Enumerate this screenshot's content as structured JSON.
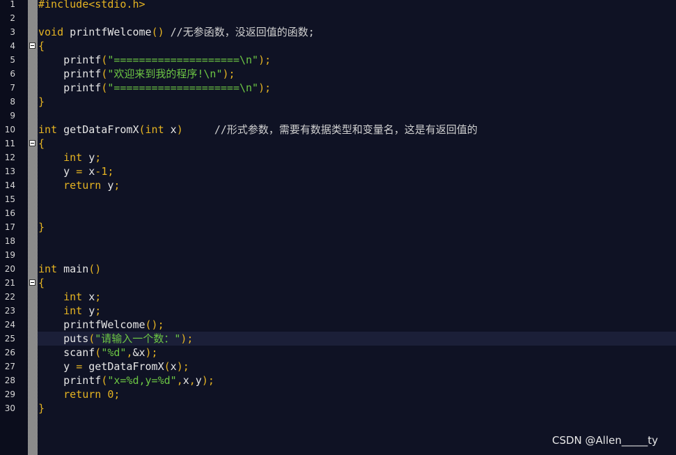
{
  "editor": {
    "colors": {
      "background": "#0f1224",
      "keyword": "#e6b422",
      "string": "#6cc644",
      "text": "#e6e6e6",
      "line_number": "#d8d8d8",
      "current_line": "#1b1f38"
    },
    "fold_markers": [
      4,
      11,
      21
    ],
    "current_line": 25,
    "lines": [
      {
        "n": "1",
        "tokens": [
          {
            "t": "pp",
            "v": "#include<stdio.h>"
          }
        ]
      },
      {
        "n": "2",
        "tokens": []
      },
      {
        "n": "3",
        "tokens": [
          {
            "t": "kw",
            "v": "void"
          },
          {
            "t": "id",
            "v": " printfWelcome"
          },
          {
            "t": "op",
            "v": "()"
          },
          {
            "t": "cmt",
            "v": " //无参函数，没返回值的函数;"
          }
        ]
      },
      {
        "n": "4",
        "tokens": [
          {
            "t": "op",
            "v": "{"
          }
        ]
      },
      {
        "n": "5",
        "tokens": [
          {
            "t": "id",
            "v": "    printf"
          },
          {
            "t": "op",
            "v": "("
          },
          {
            "t": "str",
            "v": "\"====================\\n\""
          },
          {
            "t": "op",
            "v": ");"
          }
        ]
      },
      {
        "n": "6",
        "tokens": [
          {
            "t": "id",
            "v": "    printf"
          },
          {
            "t": "op",
            "v": "("
          },
          {
            "t": "str",
            "v": "\"欢迎来到我的程序!\\n\""
          },
          {
            "t": "op",
            "v": ");"
          }
        ]
      },
      {
        "n": "7",
        "tokens": [
          {
            "t": "id",
            "v": "    printf"
          },
          {
            "t": "op",
            "v": "("
          },
          {
            "t": "str",
            "v": "\"====================\\n\""
          },
          {
            "t": "op",
            "v": ");"
          }
        ]
      },
      {
        "n": "8",
        "tokens": [
          {
            "t": "op",
            "v": "}"
          }
        ]
      },
      {
        "n": "9",
        "tokens": []
      },
      {
        "n": "10",
        "tokens": [
          {
            "t": "kw",
            "v": "int"
          },
          {
            "t": "id",
            "v": " getDataFromX"
          },
          {
            "t": "op",
            "v": "("
          },
          {
            "t": "kw",
            "v": "int"
          },
          {
            "t": "id",
            "v": " x"
          },
          {
            "t": "op",
            "v": ")"
          },
          {
            "t": "cmt",
            "v": "     //形式参数，需要有数据类型和变量名，这是有返回值的"
          }
        ]
      },
      {
        "n": "11",
        "tokens": [
          {
            "t": "op",
            "v": "{"
          }
        ]
      },
      {
        "n": "12",
        "tokens": [
          {
            "t": "kw",
            "v": "    int"
          },
          {
            "t": "id",
            "v": " y"
          },
          {
            "t": "op",
            "v": ";"
          }
        ]
      },
      {
        "n": "13",
        "tokens": [
          {
            "t": "id",
            "v": "    y "
          },
          {
            "t": "op",
            "v": "="
          },
          {
            "t": "id",
            "v": " x"
          },
          {
            "t": "op",
            "v": "-"
          },
          {
            "t": "num",
            "v": "1"
          },
          {
            "t": "op",
            "v": ";"
          }
        ]
      },
      {
        "n": "14",
        "tokens": [
          {
            "t": "kw",
            "v": "    return"
          },
          {
            "t": "id",
            "v": " y"
          },
          {
            "t": "op",
            "v": ";"
          }
        ]
      },
      {
        "n": "15",
        "tokens": []
      },
      {
        "n": "16",
        "tokens": []
      },
      {
        "n": "17",
        "tokens": [
          {
            "t": "op",
            "v": "}"
          }
        ]
      },
      {
        "n": "18",
        "tokens": []
      },
      {
        "n": "19",
        "tokens": []
      },
      {
        "n": "20",
        "tokens": [
          {
            "t": "kw",
            "v": "int"
          },
          {
            "t": "id",
            "v": " main"
          },
          {
            "t": "op",
            "v": "()"
          }
        ]
      },
      {
        "n": "21",
        "tokens": [
          {
            "t": "op",
            "v": "{"
          }
        ]
      },
      {
        "n": "22",
        "tokens": [
          {
            "t": "kw",
            "v": "    int"
          },
          {
            "t": "id",
            "v": " x"
          },
          {
            "t": "op",
            "v": ";"
          }
        ]
      },
      {
        "n": "23",
        "tokens": [
          {
            "t": "kw",
            "v": "    int"
          },
          {
            "t": "id",
            "v": " y"
          },
          {
            "t": "op",
            "v": ";"
          }
        ]
      },
      {
        "n": "24",
        "tokens": [
          {
            "t": "id",
            "v": "    printfWelcome"
          },
          {
            "t": "op",
            "v": "();"
          }
        ]
      },
      {
        "n": "25",
        "tokens": [
          {
            "t": "id",
            "v": "    puts"
          },
          {
            "t": "op",
            "v": "("
          },
          {
            "t": "str",
            "v": "\"请输入一个数：\""
          },
          {
            "t": "op",
            "v": ");"
          }
        ]
      },
      {
        "n": "26",
        "tokens": [
          {
            "t": "id",
            "v": "    scanf"
          },
          {
            "t": "op",
            "v": "("
          },
          {
            "t": "str",
            "v": "\"%d\""
          },
          {
            "t": "op",
            "v": ","
          },
          {
            "t": "id",
            "v": "&x"
          },
          {
            "t": "op",
            "v": ");"
          }
        ]
      },
      {
        "n": "27",
        "tokens": [
          {
            "t": "id",
            "v": "    y "
          },
          {
            "t": "op",
            "v": "="
          },
          {
            "t": "id",
            "v": " getDataFromX"
          },
          {
            "t": "op",
            "v": "("
          },
          {
            "t": "id",
            "v": "x"
          },
          {
            "t": "op",
            "v": ");"
          }
        ]
      },
      {
        "n": "28",
        "tokens": [
          {
            "t": "id",
            "v": "    printf"
          },
          {
            "t": "op",
            "v": "("
          },
          {
            "t": "str",
            "v": "\"x=%d,y=%d\""
          },
          {
            "t": "op",
            "v": ","
          },
          {
            "t": "id",
            "v": "x"
          },
          {
            "t": "op",
            "v": ","
          },
          {
            "t": "id",
            "v": "y"
          },
          {
            "t": "op",
            "v": ");"
          }
        ]
      },
      {
        "n": "29",
        "tokens": [
          {
            "t": "kw",
            "v": "    return"
          },
          {
            "t": "num",
            "v": " 0"
          },
          {
            "t": "op",
            "v": ";"
          }
        ]
      },
      {
        "n": "30",
        "tokens": [
          {
            "t": "op",
            "v": "}"
          }
        ]
      }
    ]
  },
  "watermark": "CSDN @Allen_____ty"
}
